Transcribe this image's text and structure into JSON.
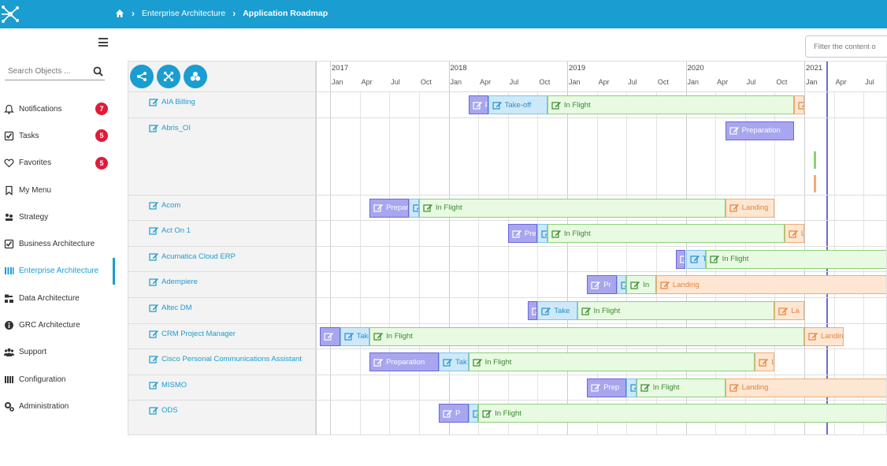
{
  "breadcrumb": {
    "section": "Enterprise Architecture",
    "page": "Application Roadmap"
  },
  "search": {
    "placeholder": "Search Objects ..."
  },
  "menu": [
    {
      "label": "Notifications",
      "icon": "bell-icon",
      "badge": "7"
    },
    {
      "label": "Tasks",
      "icon": "check-square-icon",
      "badge": "5"
    },
    {
      "label": "Favorites",
      "icon": "heart-icon",
      "badge": "5"
    },
    {
      "label": "My Menu",
      "icon": "bookmark-icon",
      "badge": ""
    },
    {
      "label": "Strategy",
      "icon": "chess-icon",
      "badge": ""
    },
    {
      "label": "Business Architecture",
      "icon": "check-square-icon",
      "badge": ""
    },
    {
      "label": "Enterprise Architecture",
      "icon": "columns-icon",
      "badge": "",
      "active": true
    },
    {
      "label": "Data Architecture",
      "icon": "sitemap-icon",
      "badge": ""
    },
    {
      "label": "GRC Architecture",
      "icon": "info-icon",
      "badge": ""
    },
    {
      "label": "Support",
      "icon": "users-icon",
      "badge": ""
    },
    {
      "label": "Configuration",
      "icon": "list-icon",
      "badge": ""
    },
    {
      "label": "Administration",
      "icon": "cogs-icon",
      "badge": ""
    }
  ],
  "filter": {
    "placeholder": "Filter the content o"
  },
  "timeline": {
    "start": "2017-01",
    "years": [
      "2017",
      "2018",
      "2019",
      "2020",
      "2021"
    ],
    "months": [
      "Jan",
      "Apr",
      "Jul",
      "Oct"
    ],
    "today": "2021-01"
  },
  "colors": {
    "accent": "#1a9dd0",
    "preparation": "#a8a6ee",
    "takeoff": "#cde9f8",
    "inflight": "#e8fae2",
    "landing": "#fde6d2",
    "badge": "#e01b3a"
  },
  "rows": [
    {
      "name": "AIA Billing",
      "height": 1,
      "bars": [
        {
          "phase": "preparation",
          "label": "P",
          "start": "2018-03",
          "end": "2018-05"
        },
        {
          "phase": "takeoff",
          "label": "Take-off",
          "start": "2018-05",
          "end": "2018-11"
        },
        {
          "phase": "inflight",
          "label": "In Flight",
          "start": "2018-11",
          "end": "2020-12"
        },
        {
          "phase": "landing",
          "label": "La",
          "start": "2020-12",
          "end": "2021-01"
        }
      ]
    },
    {
      "name": "Abris_OI",
      "height": 3,
      "bars": [
        {
          "phase": "preparation",
          "label": "Preparation",
          "start": "2020-05",
          "end": "2020-12"
        }
      ]
    },
    {
      "name": "Acom",
      "height": 1,
      "bars": [
        {
          "phase": "preparation",
          "label": "Preparation",
          "start": "2017-05",
          "end": "2017-09"
        },
        {
          "phase": "takeoff",
          "label": "T",
          "start": "2017-09",
          "end": "2017-10"
        },
        {
          "phase": "inflight",
          "label": "In Flight",
          "start": "2017-10",
          "end": "2020-05"
        },
        {
          "phase": "landing",
          "label": "Landing",
          "start": "2020-05",
          "end": "2020-10"
        }
      ]
    },
    {
      "name": "Act On 1",
      "height": 1,
      "bars": [
        {
          "phase": "preparation",
          "label": "Prep",
          "start": "2018-07",
          "end": "2018-10"
        },
        {
          "phase": "takeoff",
          "label": "T",
          "start": "2018-10",
          "end": "2018-11"
        },
        {
          "phase": "inflight",
          "label": "In Flight",
          "start": "2018-11",
          "end": "2020-11"
        },
        {
          "phase": "landing",
          "label": "L",
          "start": "2020-11",
          "end": "2021-01"
        }
      ]
    },
    {
      "name": "Acumatica Cloud ERP",
      "height": 1,
      "bars": [
        {
          "phase": "preparation",
          "label": "C",
          "start": "2019-12",
          "end": "2020-01"
        },
        {
          "phase": "takeoff",
          "label": "T",
          "start": "2020-01",
          "end": "2020-03"
        },
        {
          "phase": "inflight",
          "label": "In Flight",
          "start": "2020-03",
          "end": "2022-03"
        }
      ]
    },
    {
      "name": "Adempiere",
      "height": 1,
      "bars": [
        {
          "phase": "preparation",
          "label": "Pr",
          "start": "2019-03",
          "end": "2019-06"
        },
        {
          "phase": "takeoff",
          "label": "T",
          "start": "2019-06",
          "end": "2019-07"
        },
        {
          "phase": "inflight",
          "label": "In",
          "start": "2019-07",
          "end": "2019-10"
        },
        {
          "phase": "landing",
          "label": "Landing",
          "start": "2019-10",
          "end": "2022-03"
        }
      ]
    },
    {
      "name": "Altec DM",
      "height": 1,
      "bars": [
        {
          "phase": "preparation",
          "label": "C",
          "start": "2018-09",
          "end": "2018-10"
        },
        {
          "phase": "takeoff",
          "label": "Take",
          "start": "2018-10",
          "end": "2019-02"
        },
        {
          "phase": "inflight",
          "label": "In Flight",
          "start": "2019-02",
          "end": "2020-10"
        },
        {
          "phase": "landing",
          "label": "La",
          "start": "2020-10",
          "end": "2021-01"
        }
      ]
    },
    {
      "name": "CRM Project Manager",
      "height": 1,
      "bars": [
        {
          "phase": "preparation",
          "label": "",
          "start": "2016-12",
          "end": "2017-02"
        },
        {
          "phase": "takeoff",
          "label": "Take",
          "start": "2017-02",
          "end": "2017-05"
        },
        {
          "phase": "inflight",
          "label": "In Flight",
          "start": "2017-05",
          "end": "2021-01"
        },
        {
          "phase": "landing",
          "label": "Landin",
          "start": "2021-01",
          "end": "2021-05"
        }
      ]
    },
    {
      "name": "Cisco Personal Communications Assistant",
      "height": 1,
      "bars": [
        {
          "phase": "preparation",
          "label": "Preparation",
          "start": "2017-05",
          "end": "2017-12"
        },
        {
          "phase": "takeoff",
          "label": "Tak",
          "start": "2017-12",
          "end": "2018-03"
        },
        {
          "phase": "inflight",
          "label": "In Flight",
          "start": "2018-03",
          "end": "2020-08"
        },
        {
          "phase": "landing",
          "label": "La",
          "start": "2020-08",
          "end": "2020-10"
        }
      ]
    },
    {
      "name": "MISMO",
      "height": 1,
      "bars": [
        {
          "phase": "preparation",
          "label": "Prep",
          "start": "2019-03",
          "end": "2019-07"
        },
        {
          "phase": "takeoff",
          "label": "",
          "start": "2019-07",
          "end": "2019-08"
        },
        {
          "phase": "inflight",
          "label": "In Flight",
          "start": "2019-08",
          "end": "2020-05"
        },
        {
          "phase": "landing",
          "label": "Landing",
          "start": "2020-05",
          "end": "2022-03"
        }
      ]
    },
    {
      "name": "ODS",
      "height": 1,
      "bars": [
        {
          "phase": "preparation",
          "label": "P",
          "start": "2017-12",
          "end": "2018-03"
        },
        {
          "phase": "takeoff",
          "label": "",
          "start": "2018-03",
          "end": "2018-04"
        },
        {
          "phase": "inflight",
          "label": "In Flight",
          "start": "2018-04",
          "end": "2022-03"
        }
      ]
    }
  ]
}
